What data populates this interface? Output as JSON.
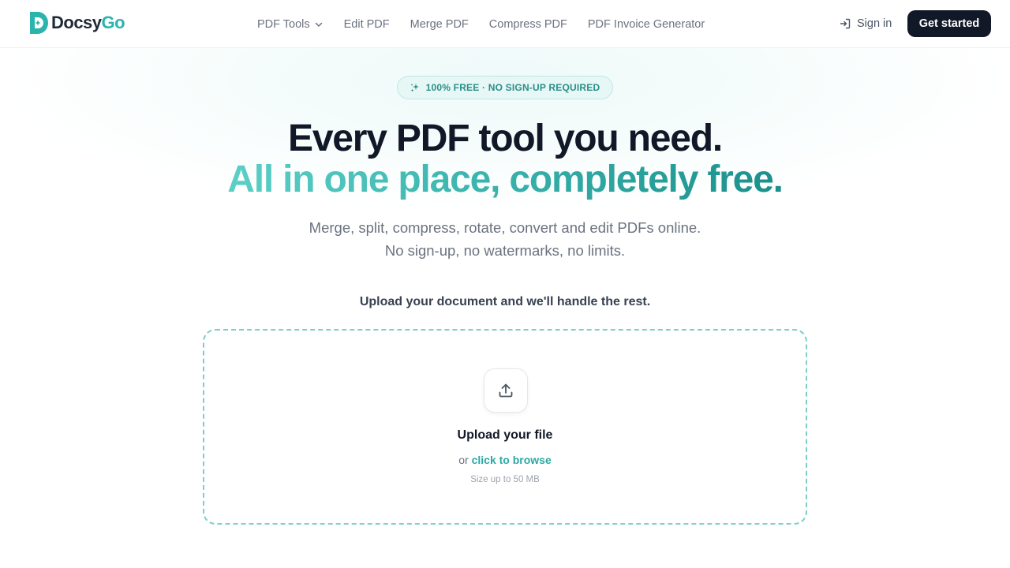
{
  "header": {
    "logo": {
      "part1": "Docsy",
      "part2": "Go"
    },
    "nav": [
      {
        "label": "PDF Tools",
        "has_dropdown": true,
        "icon": "chevron-down-icon"
      },
      {
        "label": "Edit PDF"
      },
      {
        "label": "Merge PDF"
      },
      {
        "label": "Compress PDF"
      },
      {
        "label": "PDF Invoice Generator"
      }
    ],
    "sign_in": {
      "label": "Sign in",
      "icon": "sign-in-icon"
    },
    "cta": {
      "label": "Get started"
    }
  },
  "hero": {
    "badge": {
      "text": "100% FREE · NO SIGN-UP REQUIRED",
      "icon": "sparkle-icon"
    },
    "title_line1": "Every PDF tool you need.",
    "title_line2": "All in one place, completely free.",
    "subtitle": "Merge, split, compress, rotate, convert and edit PDFs online. No sign-up, no watermarks, no limits."
  },
  "upload": {
    "prompt": "Upload your document and we'll handle the rest.",
    "dropzone": {
      "icon": "upload-icon",
      "title": "Upload your file",
      "browse_prefix": "or ",
      "browse_link": "click to browse",
      "size_note": "Size up to 50 MB"
    }
  },
  "colors": {
    "brand_teal": "#2bb3ad",
    "dark": "#111827",
    "muted_text": "#6b7280",
    "dropzone_border": "#7ccfca",
    "badge_bg": "#e6f7f5"
  }
}
